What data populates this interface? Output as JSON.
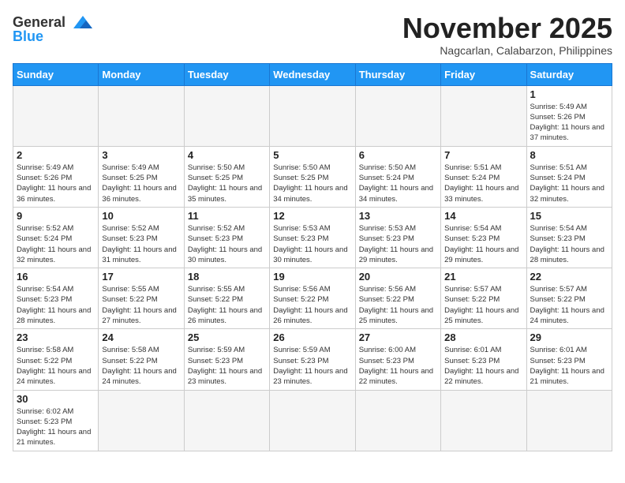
{
  "header": {
    "logo_general": "General",
    "logo_blue": "Blue",
    "month_title": "November 2025",
    "location": "Nagcarlan, Calabarzon, Philippines"
  },
  "weekdays": [
    "Sunday",
    "Monday",
    "Tuesday",
    "Wednesday",
    "Thursday",
    "Friday",
    "Saturday"
  ],
  "weeks": [
    [
      {
        "day": "",
        "empty": true
      },
      {
        "day": "",
        "empty": true
      },
      {
        "day": "",
        "empty": true
      },
      {
        "day": "",
        "empty": true
      },
      {
        "day": "",
        "empty": true
      },
      {
        "day": "",
        "empty": true
      },
      {
        "day": "1",
        "sunrise": "5:49 AM",
        "sunset": "5:26 PM",
        "daylight": "11 hours and 37 minutes."
      }
    ],
    [
      {
        "day": "2",
        "sunrise": "5:49 AM",
        "sunset": "5:26 PM",
        "daylight": "11 hours and 36 minutes."
      },
      {
        "day": "3",
        "sunrise": "5:49 AM",
        "sunset": "5:25 PM",
        "daylight": "11 hours and 36 minutes."
      },
      {
        "day": "4",
        "sunrise": "5:50 AM",
        "sunset": "5:25 PM",
        "daylight": "11 hours and 35 minutes."
      },
      {
        "day": "5",
        "sunrise": "5:50 AM",
        "sunset": "5:25 PM",
        "daylight": "11 hours and 34 minutes."
      },
      {
        "day": "6",
        "sunrise": "5:50 AM",
        "sunset": "5:24 PM",
        "daylight": "11 hours and 34 minutes."
      },
      {
        "day": "7",
        "sunrise": "5:51 AM",
        "sunset": "5:24 PM",
        "daylight": "11 hours and 33 minutes."
      },
      {
        "day": "8",
        "sunrise": "5:51 AM",
        "sunset": "5:24 PM",
        "daylight": "11 hours and 32 minutes."
      }
    ],
    [
      {
        "day": "9",
        "sunrise": "5:52 AM",
        "sunset": "5:24 PM",
        "daylight": "11 hours and 32 minutes."
      },
      {
        "day": "10",
        "sunrise": "5:52 AM",
        "sunset": "5:23 PM",
        "daylight": "11 hours and 31 minutes."
      },
      {
        "day": "11",
        "sunrise": "5:52 AM",
        "sunset": "5:23 PM",
        "daylight": "11 hours and 30 minutes."
      },
      {
        "day": "12",
        "sunrise": "5:53 AM",
        "sunset": "5:23 PM",
        "daylight": "11 hours and 30 minutes."
      },
      {
        "day": "13",
        "sunrise": "5:53 AM",
        "sunset": "5:23 PM",
        "daylight": "11 hours and 29 minutes."
      },
      {
        "day": "14",
        "sunrise": "5:54 AM",
        "sunset": "5:23 PM",
        "daylight": "11 hours and 29 minutes."
      },
      {
        "day": "15",
        "sunrise": "5:54 AM",
        "sunset": "5:23 PM",
        "daylight": "11 hours and 28 minutes."
      }
    ],
    [
      {
        "day": "16",
        "sunrise": "5:54 AM",
        "sunset": "5:23 PM",
        "daylight": "11 hours and 28 minutes."
      },
      {
        "day": "17",
        "sunrise": "5:55 AM",
        "sunset": "5:22 PM",
        "daylight": "11 hours and 27 minutes."
      },
      {
        "day": "18",
        "sunrise": "5:55 AM",
        "sunset": "5:22 PM",
        "daylight": "11 hours and 26 minutes."
      },
      {
        "day": "19",
        "sunrise": "5:56 AM",
        "sunset": "5:22 PM",
        "daylight": "11 hours and 26 minutes."
      },
      {
        "day": "20",
        "sunrise": "5:56 AM",
        "sunset": "5:22 PM",
        "daylight": "11 hours and 25 minutes."
      },
      {
        "day": "21",
        "sunrise": "5:57 AM",
        "sunset": "5:22 PM",
        "daylight": "11 hours and 25 minutes."
      },
      {
        "day": "22",
        "sunrise": "5:57 AM",
        "sunset": "5:22 PM",
        "daylight": "11 hours and 24 minutes."
      }
    ],
    [
      {
        "day": "23",
        "sunrise": "5:58 AM",
        "sunset": "5:22 PM",
        "daylight": "11 hours and 24 minutes."
      },
      {
        "day": "24",
        "sunrise": "5:58 AM",
        "sunset": "5:22 PM",
        "daylight": "11 hours and 24 minutes."
      },
      {
        "day": "25",
        "sunrise": "5:59 AM",
        "sunset": "5:23 PM",
        "daylight": "11 hours and 23 minutes."
      },
      {
        "day": "26",
        "sunrise": "5:59 AM",
        "sunset": "5:23 PM",
        "daylight": "11 hours and 23 minutes."
      },
      {
        "day": "27",
        "sunrise": "6:00 AM",
        "sunset": "5:23 PM",
        "daylight": "11 hours and 22 minutes."
      },
      {
        "day": "28",
        "sunrise": "6:01 AM",
        "sunset": "5:23 PM",
        "daylight": "11 hours and 22 minutes."
      },
      {
        "day": "29",
        "sunrise": "6:01 AM",
        "sunset": "5:23 PM",
        "daylight": "11 hours and 21 minutes."
      }
    ],
    [
      {
        "day": "30",
        "sunrise": "6:02 AM",
        "sunset": "5:23 PM",
        "daylight": "11 hours and 21 minutes."
      },
      {
        "day": "",
        "empty": true
      },
      {
        "day": "",
        "empty": true
      },
      {
        "day": "",
        "empty": true
      },
      {
        "day": "",
        "empty": true
      },
      {
        "day": "",
        "empty": true
      },
      {
        "day": "",
        "empty": true
      }
    ]
  ],
  "labels": {
    "sunrise": "Sunrise:",
    "sunset": "Sunset:",
    "daylight": "Daylight:"
  }
}
